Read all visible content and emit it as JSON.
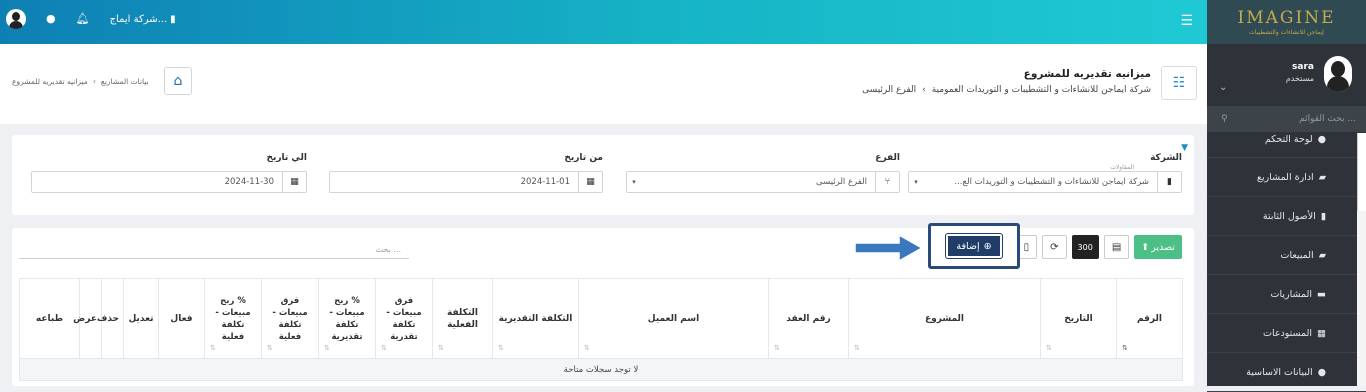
{
  "topbar": {
    "company_label": "شركة ايماج...",
    "icons": [
      "avatar-icon",
      "chat-icon",
      "bell-icon",
      "building-icon",
      "menu-icon"
    ]
  },
  "sidebar": {
    "logo_text": "IMAGINE",
    "logo_sub": "إيماجن للانشاءات والتشطيبات",
    "user_name": "sara",
    "user_role": "مستخدم",
    "search_placeholder": "بحث القوائم ...",
    "items": [
      {
        "label": "لوحة التحكم",
        "icon": "info-circle-icon"
      },
      {
        "label": "ادارة المشاريع",
        "icon": "handshake-icon"
      },
      {
        "label": "الأصول الثابتة",
        "icon": "file-icon"
      },
      {
        "label": "المبيعات",
        "icon": "truck-icon"
      },
      {
        "label": "المشاريات",
        "icon": "tv-icon"
      },
      {
        "label": "المستودعات",
        "icon": "warehouse-icon"
      },
      {
        "label": "البيانات الاساسية",
        "icon": "info-circle-icon"
      }
    ]
  },
  "header": {
    "title": "ميزانيه تقديريه للمشروع",
    "crumb_company": "شركة ايماجن للانشاءات و التشطيبات و التوريدات العمومية",
    "crumb_branch": "الفرع الرئيسى",
    "breadcrumb": [
      "بيانات المشاريع",
      "ميزانيه تقديريه للمشروع"
    ]
  },
  "filters": {
    "company_label": "الشركة",
    "company_sub": "المقاولات",
    "company_value": "شركة ايماجن للانشاءات و التشطيبات و التوريدات الع...",
    "branch_label": "الفرع",
    "branch_value": "الفرع الرئيسى",
    "from_label": "من تاريخ",
    "from_value": "2024-11-01",
    "to_label": "الي تاريخ",
    "to_value": "2024-11-30"
  },
  "toolbar": {
    "export_label": "تصدير",
    "page_size": "300",
    "add_label": "إضافة",
    "search_placeholder": "بحث ..."
  },
  "table": {
    "columns": [
      "الرقم",
      "التاريخ",
      "المشروع",
      "رقم العقد",
      "اسم العميل",
      "التكلفة التقديرية",
      "التكلفة الفعلية",
      "فرق مبيعات - تكلفة تقدرية",
      "% ربح مبيعات - تكلفة تقديرية",
      "فرق مبيعات - تكلفة فعلية",
      "% ربح مبيعات - تكلفة فعلية",
      "فعال",
      "تعديل",
      "حذف",
      "عرض",
      "طباعه"
    ],
    "empty_text": "لا توجد سجلات متاحة"
  }
}
